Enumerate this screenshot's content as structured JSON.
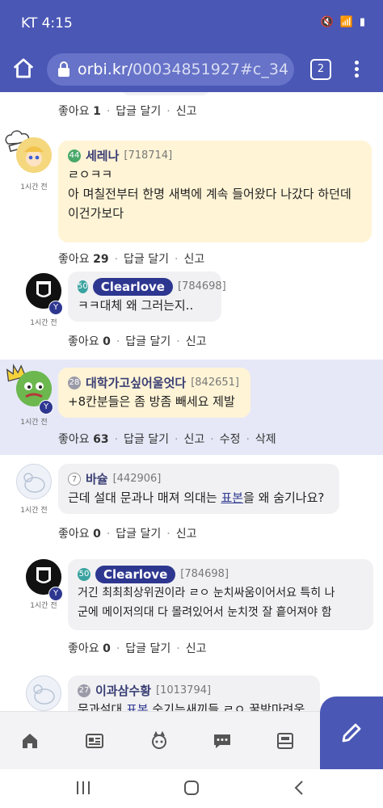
{
  "status": {
    "time": "KT 4:15"
  },
  "browser": {
    "url_main": "orbi.kr/",
    "url_rest": "00034851927#c_34",
    "tab_count": "2"
  },
  "comments": [
    {
      "actions": {
        "like_label": "좋아요",
        "like_count": "1",
        "reply": "답글 달기",
        "report": "신고"
      }
    },
    {
      "name": "세레나",
      "level": "44",
      "uid": "[718714]",
      "ago": "1시간 전",
      "text1": "ㄹㅇㅋㅋ",
      "text2": "아 며칠전부터 한명 새벽에 계속 들어왔다 나갔다 하던데",
      "text3": "이건가보다",
      "actions": {
        "like_label": "좋아요",
        "like_count": "29",
        "reply": "답글 달기",
        "report": "신고"
      }
    },
    {
      "name": "Clearlove",
      "level": "50",
      "uid": "[784698]",
      "ago": "1시간 전",
      "text1": "ㅋㅋ대체 왜 그러는지..",
      "actions": {
        "like_label": "좋아요",
        "like_count": "0",
        "reply": "답글 달기",
        "report": "신고"
      }
    },
    {
      "name": "대학가고싶어울엇다",
      "level": "28",
      "uid": "[842651]",
      "ago": "1시간 전",
      "text1": "+8칸분들은 좀 방좀 빼세요 제발",
      "actions": {
        "like_label": "좋아요",
        "like_count": "63",
        "reply": "답글 달기",
        "report": "신고",
        "edit": "수정",
        "delete": "삭제"
      }
    },
    {
      "name": "바슐",
      "level": "7",
      "uid": "[442906]",
      "ago": "1시간 전",
      "text_a": "근데 설대 문과나 매져 의대는 ",
      "text_link": "표본",
      "text_b": "을 왜 숨기나요?",
      "actions": {
        "like_label": "좋아요",
        "like_count": "0",
        "reply": "답글 달기",
        "report": "신고"
      }
    },
    {
      "name": "Clearlove",
      "level": "50",
      "uid": "[784698]",
      "ago": "1시간 전",
      "text1": "거긴 최최최상위권이라 ㄹㅇ 눈치싸움이어서요 특히 나",
      "text2": "군에 메이저의대 다 몰려있어서 눈치껏 잘 흩어져야 함",
      "actions": {
        "like_label": "좋아요",
        "like_count": "0",
        "reply": "답글 달기",
        "report": "신고"
      }
    },
    {
      "name": "이과삼수황",
      "level": "27",
      "uid": "[1013794]",
      "text_a": "문과설대 ",
      "text_link": "표본",
      "text_b": " 숨기는새끼들 ㄹㅇ 꿀밤마려움"
    }
  ],
  "colors": {
    "brand": "#4a57b5",
    "highlight": "#e6e8f7",
    "bubble_yellow": "#fff4d6",
    "bubble_gray": "#f1f1f3",
    "name_pill": "#2e3790"
  }
}
